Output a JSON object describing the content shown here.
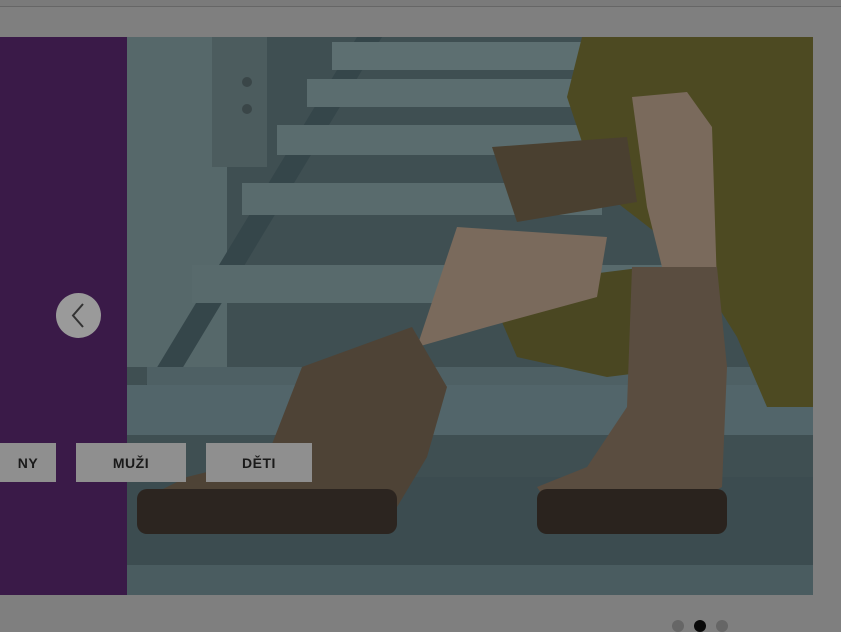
{
  "slider": {
    "prev_button_icon": "chevron-left-icon",
    "categories": [
      "NY",
      "MUŽI",
      "DĚTI"
    ],
    "panel_color": "#3a1a48",
    "dots_count": 3,
    "active_dot": 2
  }
}
